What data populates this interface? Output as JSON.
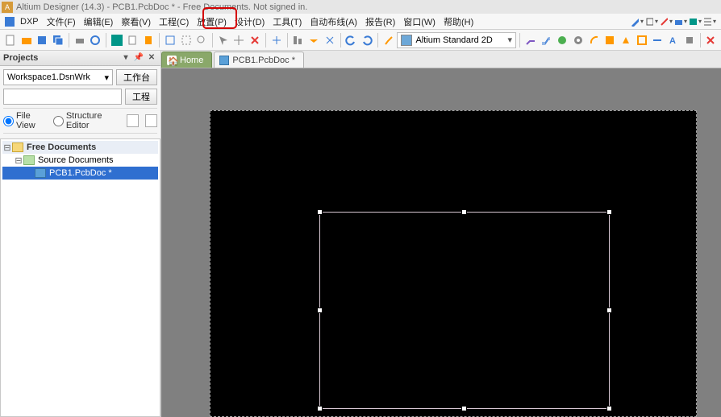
{
  "title": "Altium Designer (14.3) - PCB1.PcbDoc * - Free Documents. Not signed in.",
  "menu": {
    "dxp": "DXP",
    "file": "文件(F)",
    "edit": "编辑(E)",
    "view": "察看(V)",
    "project": "工程(C)",
    "place": "放置(P)",
    "design": "设计(D)",
    "tools": "工具(T)",
    "autoroute": "自动布线(A)",
    "report": "报告(R)",
    "window": "窗口(W)",
    "help": "帮助(H)"
  },
  "display_mode": "Altium Standard 2D",
  "projects_panel": {
    "title": "Projects",
    "workspace": "Workspace1.DsnWrk",
    "workspace_btn": "工作台",
    "project_btn": "工程",
    "file_view": "File View",
    "structure_editor": "Structure Editor"
  },
  "tree": {
    "root": "Free Documents",
    "src": "Source Documents",
    "doc": "PCB1.PcbDoc *"
  },
  "tabs": {
    "home": "Home",
    "doc": "PCB1.PcbDoc *"
  }
}
